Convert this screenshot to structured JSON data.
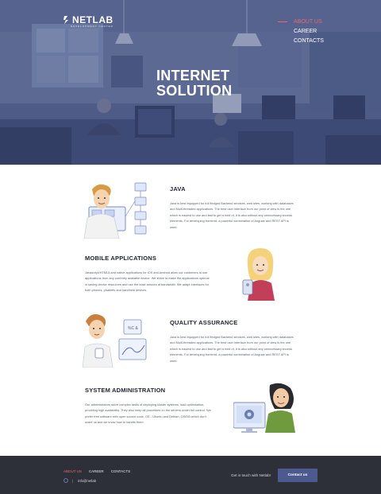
{
  "header": {
    "logo_text": "NETLAB",
    "logo_subtext": "DEVELOPMENT CENTER",
    "nav": [
      {
        "label": "ABOUT US",
        "active": true
      },
      {
        "label": "CAREER",
        "active": false
      },
      {
        "label": "CONTACTS",
        "active": false
      }
    ],
    "hero_title_line1": "INTERNET",
    "hero_title_line2": "SOLUTION"
  },
  "sections": [
    {
      "title": "JAVA",
      "body": "Java is best equipped for full fledged Backend services, web sites, working with databases and Multi-threaded applications. The best user interface from our point of view is the one which is easiest to use and fast to get a hold of, it is also without any unnecessary excess elements. For developing frontend, a powerful combination of Angular and REST API is used.",
      "illustration": "developer-with-diagram"
    },
    {
      "title": "MOBILE APPLICATIONS",
      "body": "Javascript/HTML5 and native applications for iOS and Android allow our customers to use applications from any currently available device. We strive to make the applications optimal in saving device resources and use the least amount of bandwidth. We adapt interfaces for both phones, phablets and handheld devices.",
      "illustration": "woman-with-phone"
    },
    {
      "title": "QUALITY ASSURANCE",
      "body": "Java is best equipped for full fledged Backend services, web sites, working with databases and Multi-threaded applications. The best user interface from our point of view is the one which is easiest to use and fast to get a hold of, it is also without any unnecessary excess elements. For developing frontend, a powerful combination of Angular and REST API is used.",
      "illustration": "tester-with-charts",
      "chart_label": "%C &"
    },
    {
      "title": "SYSTEM ADMINISTRATION",
      "body": "Our administrators solve complex tasks of deploying cluster systems, load optimisation, providing high availability. They also keep all processes on the servers under full control. We prefer free software with open source code, OS - Ubuntu and Debian, OS/DB which don't scare us and we know how to handle them.",
      "illustration": "admin-with-monitor"
    }
  ],
  "footer": {
    "nav": [
      {
        "label": "ABOUT US",
        "active": true
      },
      {
        "label": "CAREER",
        "active": false
      },
      {
        "label": "CONTACTS",
        "active": false
      }
    ],
    "phone_icon": "phone-icon",
    "email": "info@netlab",
    "cta_text": "Get in touch with Netlab!",
    "cta_button": "Contact us"
  },
  "colors": {
    "accent": "#e8696e",
    "hero_tint": "#3c4a74",
    "footer_bg": "#2d3038",
    "button_bg": "#4d5a8f"
  }
}
